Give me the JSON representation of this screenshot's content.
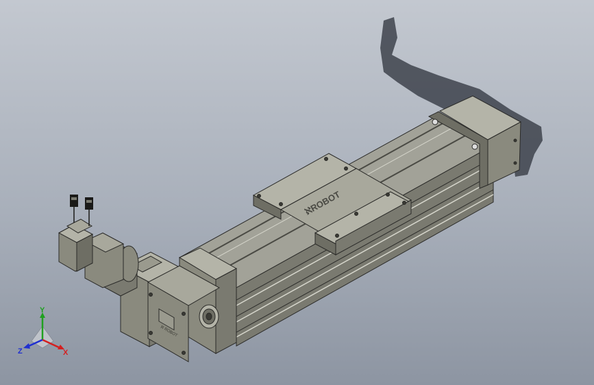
{
  "model": {
    "brand_mark_carriage": "ℵROBOT",
    "brand_mark_endplate": "ℵ ROBOT",
    "colors": {
      "body": "#8a8a7e",
      "body_light": "#b4b4a8",
      "body_dark": "#5e5e56",
      "edge": "#2a2a28",
      "shadow": "#3e434c"
    }
  },
  "triad": {
    "x_label": "X",
    "y_label": "Y",
    "z_label": "Z",
    "colors": {
      "x": "#d42020",
      "y": "#20a020",
      "z": "#2030d0"
    }
  }
}
